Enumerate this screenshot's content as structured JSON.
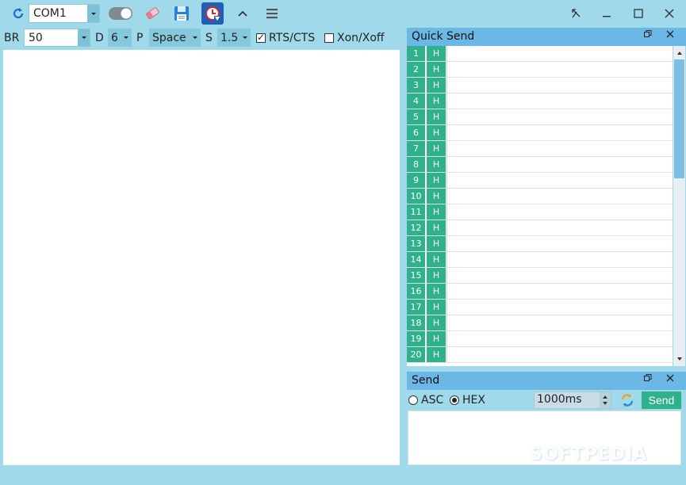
{
  "toolbar": {
    "port": "COM1",
    "icons": [
      "refresh-icon",
      "toggle-switch-icon",
      "eraser-icon",
      "save-icon",
      "timer-clock-icon",
      "chevron-up-icon",
      "menu-icon"
    ],
    "window_controls": [
      "pin-icon",
      "minimize-icon",
      "maximize-icon",
      "close-icon"
    ]
  },
  "settings": {
    "br_label": "BR",
    "br_value": "50",
    "d_label": "D",
    "d_value": "6",
    "p_label": "P",
    "p_value": "Space",
    "s_label": "S",
    "s_value": "1.5",
    "rts_label": "RTS/CTS",
    "rts_checked": true,
    "xon_label": "Xon/Xoff",
    "xon_checked": false
  },
  "quick_send": {
    "title": "Quick Send",
    "rows": [
      {
        "num": "1",
        "mode": "H"
      },
      {
        "num": "2",
        "mode": "H"
      },
      {
        "num": "3",
        "mode": "H"
      },
      {
        "num": "4",
        "mode": "H"
      },
      {
        "num": "5",
        "mode": "H"
      },
      {
        "num": "6",
        "mode": "H"
      },
      {
        "num": "7",
        "mode": "H"
      },
      {
        "num": "8",
        "mode": "H"
      },
      {
        "num": "9",
        "mode": "H"
      },
      {
        "num": "10",
        "mode": "H"
      },
      {
        "num": "11",
        "mode": "H"
      },
      {
        "num": "12",
        "mode": "H"
      },
      {
        "num": "13",
        "mode": "H"
      },
      {
        "num": "14",
        "mode": "H"
      },
      {
        "num": "15",
        "mode": "H"
      },
      {
        "num": "16",
        "mode": "H"
      },
      {
        "num": "17",
        "mode": "H"
      },
      {
        "num": "18",
        "mode": "H"
      },
      {
        "num": "19",
        "mode": "H"
      },
      {
        "num": "20",
        "mode": "H"
      }
    ]
  },
  "send": {
    "title": "Send",
    "asc_label": "ASC",
    "hex_label": "HEX",
    "mode_selected": "HEX",
    "interval": "1000ms",
    "send_label": "Send"
  },
  "watermark": "SOFTPEDIA",
  "colors": {
    "background": "#9fd9ea",
    "panel_header": "#6bb8e6",
    "accent_green": "#2fb28c",
    "toolbar_blue": "#1a6fd0"
  }
}
